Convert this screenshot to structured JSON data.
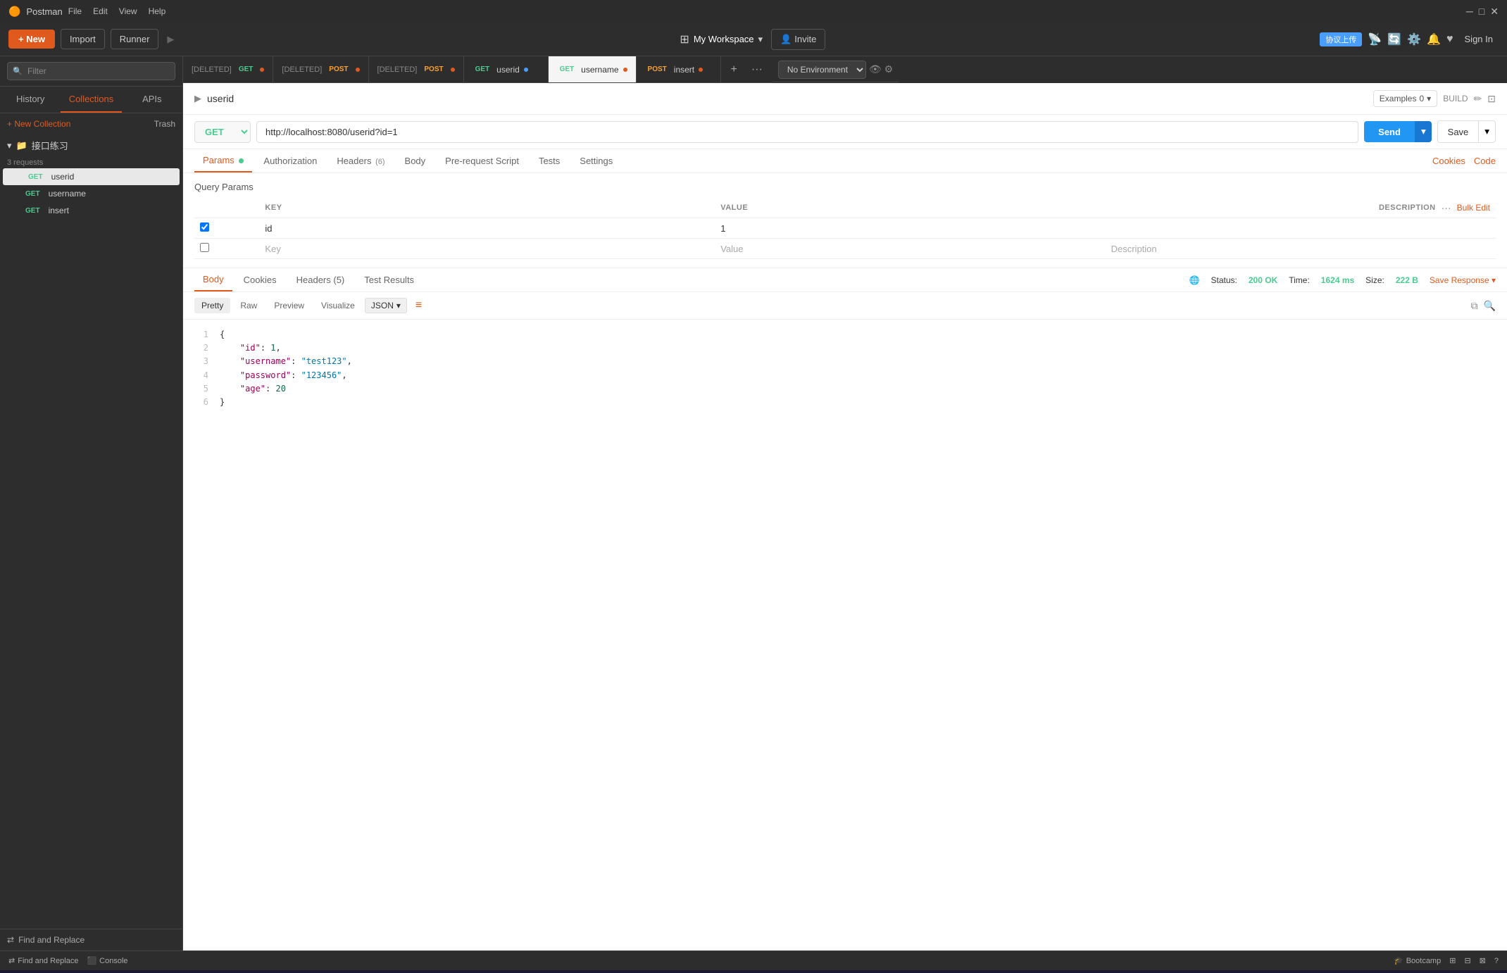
{
  "app": {
    "title": "Postman",
    "logo": "🟠"
  },
  "titlebar": {
    "title": "Postman",
    "menu": [
      "File",
      "Edit",
      "View",
      "Help"
    ],
    "controls": {
      "minimize": "─",
      "maximize": "□",
      "close": "✕"
    }
  },
  "navbar": {
    "new_label": "+ New",
    "import_label": "Import",
    "runner_label": "Runner",
    "workspace_label": "My Workspace",
    "invite_label": "Invite",
    "sign_in_label": "Sign In",
    "upload_label": "协议上传"
  },
  "sidebar": {
    "filter_placeholder": "Filter",
    "tabs": [
      {
        "id": "history",
        "label": "History"
      },
      {
        "id": "collections",
        "label": "Collections"
      },
      {
        "id": "apis",
        "label": "APIs"
      }
    ],
    "active_tab": "collections",
    "new_collection_label": "+ New Collection",
    "trash_label": "Trash",
    "collections": [
      {
        "name": "接口练习",
        "count": "3 requests",
        "expanded": true,
        "requests": [
          {
            "method": "GET",
            "name": "userid",
            "active": true
          },
          {
            "method": "GET",
            "name": "username"
          },
          {
            "method": "GET",
            "name": "insert"
          }
        ]
      }
    ],
    "find_replace_label": "Find and Replace"
  },
  "tabs": [
    {
      "id": "tab1",
      "method": "GET",
      "label": "[DELETED]",
      "has_dot": true,
      "dot_color": "orange",
      "deleted": true
    },
    {
      "id": "tab2",
      "method": "POST",
      "label": "[DELETED]",
      "has_dot": true,
      "dot_color": "orange",
      "deleted": true
    },
    {
      "id": "tab3",
      "method": "POST",
      "label": "[DELETED]",
      "has_dot": true,
      "dot_color": "orange",
      "deleted": true
    },
    {
      "id": "tab4",
      "method": "GET",
      "label": "userid",
      "has_dot": true,
      "dot_color": "blue"
    },
    {
      "id": "tab5",
      "method": "GET",
      "label": "username",
      "has_dot": true,
      "dot_color": "orange",
      "active": true
    },
    {
      "id": "tab6",
      "method": "POST",
      "label": "insert",
      "has_dot": true,
      "dot_color": "orange"
    }
  ],
  "environment": {
    "label": "No Environment",
    "placeholder": "No Environment"
  },
  "request": {
    "name": "userid",
    "method": "GET",
    "url": "http://localhost:8080/userid?id=1",
    "examples_label": "Examples",
    "examples_count": "0",
    "build_label": "BUILD",
    "send_label": "Send",
    "save_label": "Save"
  },
  "request_tabs": {
    "tabs": [
      {
        "id": "params",
        "label": "Params",
        "has_dot": true
      },
      {
        "id": "authorization",
        "label": "Authorization"
      },
      {
        "id": "headers",
        "label": "Headers",
        "count": "(6)"
      },
      {
        "id": "body",
        "label": "Body"
      },
      {
        "id": "pre_request",
        "label": "Pre-request Script"
      },
      {
        "id": "tests",
        "label": "Tests"
      },
      {
        "id": "settings",
        "label": "Settings"
      }
    ],
    "active_tab": "params",
    "cookies_label": "Cookies",
    "code_label": "Code"
  },
  "params": {
    "title": "Query Params",
    "columns": {
      "key": "KEY",
      "value": "VALUE",
      "description": "DESCRIPTION"
    },
    "bulk_edit_label": "Bulk Edit",
    "rows": [
      {
        "checked": true,
        "key": "id",
        "value": "1",
        "description": ""
      }
    ],
    "empty_row": {
      "key_placeholder": "Key",
      "value_placeholder": "Value",
      "description_placeholder": "Description"
    }
  },
  "response": {
    "tabs": [
      {
        "id": "body",
        "label": "Body",
        "active": true
      },
      {
        "id": "cookies",
        "label": "Cookies"
      },
      {
        "id": "headers",
        "label": "Headers (5)"
      },
      {
        "id": "test_results",
        "label": "Test Results"
      }
    ],
    "status": "200 OK",
    "time": "1624 ms",
    "size": "222 B",
    "save_response_label": "Save Response",
    "format_tabs": [
      "Pretty",
      "Raw",
      "Preview",
      "Visualize"
    ],
    "active_format": "Pretty",
    "json_label": "JSON",
    "body_lines": [
      {
        "num": "1",
        "text": "{"
      },
      {
        "num": "2",
        "text": "    \"id\": 1,"
      },
      {
        "num": "3",
        "text": "    \"username\": \"test123\","
      },
      {
        "num": "4",
        "text": "    \"password\": \"123456\","
      },
      {
        "num": "5",
        "text": "    \"age\": 20"
      },
      {
        "num": "6",
        "text": "}"
      }
    ],
    "body_data": {
      "id": 1,
      "username": "test123",
      "password": "123456",
      "age": 20
    }
  },
  "statusbar": {
    "find_replace": "Find and Replace",
    "console": "Console",
    "bootcamp": "Bootcamp"
  }
}
